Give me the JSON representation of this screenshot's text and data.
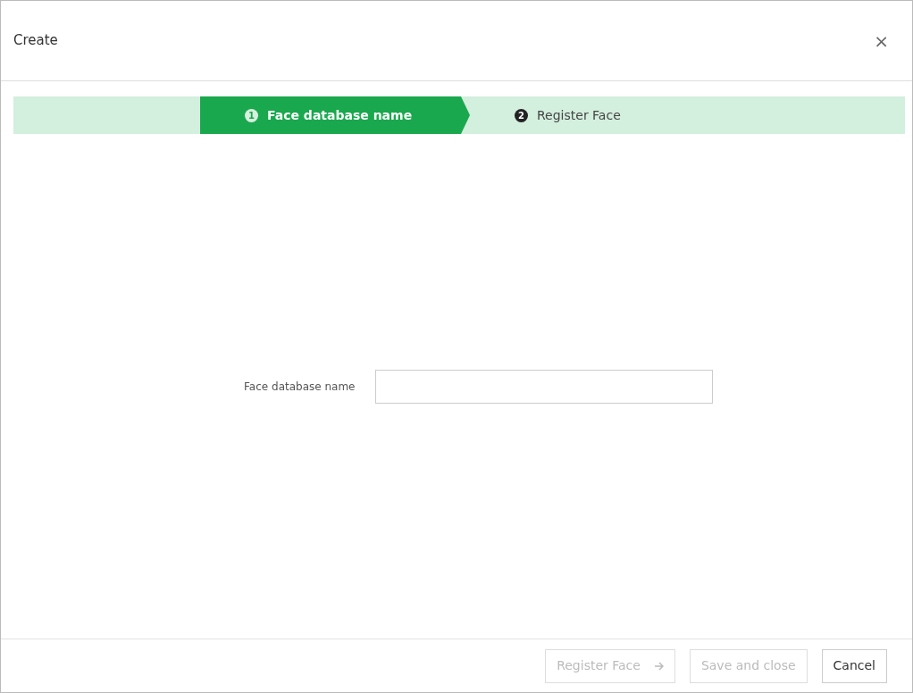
{
  "dialog": {
    "title": "Create",
    "close": "×"
  },
  "steps": [
    {
      "number": "1",
      "label": "Face database name",
      "selected": true
    },
    {
      "number": "2",
      "label": "Register Face",
      "selected": false
    }
  ],
  "form": {
    "label": "Face database name"
  },
  "buttons": [
    {
      "label": "Register Face",
      "kind": "next",
      "disabled": true
    },
    {
      "label": "Save and close",
      "kind": "plain",
      "disabled": true
    },
    {
      "label": "Cancel",
      "kind": "plain",
      "disabled": false
    }
  ]
}
